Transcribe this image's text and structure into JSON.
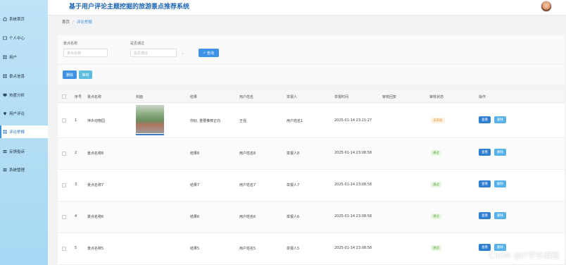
{
  "app": {
    "title": "基于用户评论主题挖掘的旅游景点推荐系统"
  },
  "sidebar": {
    "items": [
      {
        "label": "系统首页",
        "icon": "home-icon"
      },
      {
        "label": "个人中心",
        "icon": "user-card-icon"
      },
      {
        "label": "用户",
        "icon": "grid-icon"
      },
      {
        "label": "景点信息",
        "icon": "grid-icon"
      },
      {
        "label": "热度分析",
        "icon": "monitor-icon"
      },
      {
        "label": "用户评论",
        "icon": "location-icon"
      },
      {
        "label": "评论举报",
        "icon": "grid-icon"
      },
      {
        "label": "反馈投诉",
        "icon": "list-icon"
      },
      {
        "label": "系统管理",
        "icon": "list-icon"
      }
    ],
    "active_index": 6
  },
  "breadcrumb": {
    "home": "首页",
    "separator": "/",
    "current": "评论举报"
  },
  "search": {
    "field1_label": "景点名称",
    "field1_placeholder": "景点名称",
    "field2_label": "是否通过",
    "field2_placeholder": "是否通过",
    "query_label": "查询"
  },
  "actions": {
    "delete_label": "删除",
    "review_label": "审核"
  },
  "table": {
    "headers": [
      "序号",
      "景点名称",
      "封面",
      "结果",
      "用户姓名",
      "举报人",
      "举报时间",
      "审核回复",
      "审核状态",
      "操作"
    ],
    "rows": [
      {
        "index": "1",
        "name": "萍乡动物园",
        "result": "你好, 重要推荐正向",
        "user": "王强",
        "reporter": "用户姓名1",
        "time": "2025-01-14 23:21:27",
        "status": "未审核",
        "status_type": "pending",
        "has_cover": true
      },
      {
        "index": "2",
        "name": "景点名称8",
        "result": "结果8",
        "user": "用户姓名8",
        "reporter": "举报人8",
        "time": "2025-01-14 23:08:58",
        "status": "通过",
        "status_type": "pass",
        "has_cover": false
      },
      {
        "index": "3",
        "name": "景点名称7",
        "result": "结果7",
        "user": "用户姓名7",
        "reporter": "举报人7",
        "time": "2025-01-14 23:08:58",
        "status": "通过",
        "status_type": "pass",
        "has_cover": false
      },
      {
        "index": "4",
        "name": "景点名称6",
        "result": "结果6",
        "user": "用户姓名6",
        "reporter": "举报人6",
        "time": "2025-01-14 23:08:58",
        "status": "通过",
        "status_type": "pass",
        "has_cover": false
      },
      {
        "index": "5",
        "name": "景点名称5",
        "result": "结果5",
        "user": "用户姓名5",
        "reporter": "举报人5",
        "time": "2025-01-14 23:08:58",
        "status": "通过",
        "status_type": "pass",
        "has_cover": false
      }
    ],
    "view_label": "查看",
    "delete_label": "删除"
  },
  "watermark": "CSDN @IT学长编程",
  "colors": {
    "sidebar_bg": "#a7d8f3",
    "primary": "#3e92e6",
    "title": "#1f66b3"
  }
}
